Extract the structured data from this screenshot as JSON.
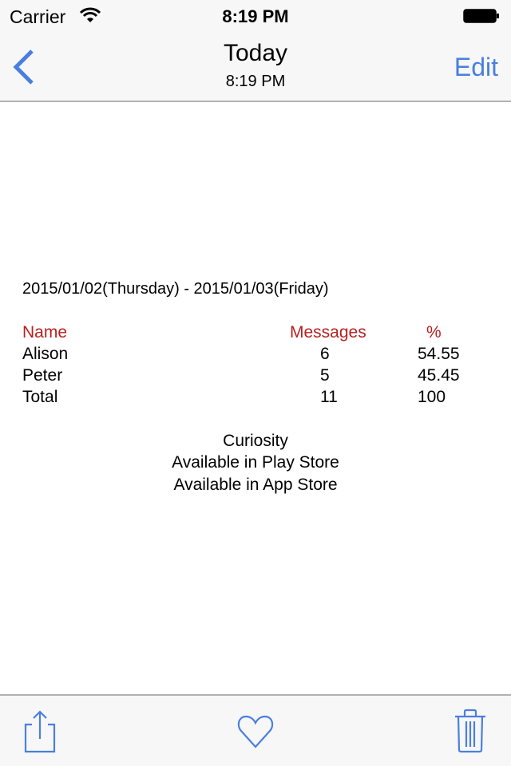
{
  "status_bar": {
    "carrier": "Carrier",
    "time": "8:19 PM",
    "wifi_icon": "wifi-icon",
    "battery_icon": "battery-full-icon"
  },
  "nav": {
    "back_icon": "chevron-left-icon",
    "title": "Today",
    "subtitle": "8:19 PM",
    "edit_label": "Edit",
    "accent_color": "#4a7fe0"
  },
  "report": {
    "date_range": "2015/01/02(Thursday) - 2015/01/03(Friday)",
    "header_color": "#b81f1f",
    "columns": [
      "Name",
      "Messages",
      "%"
    ],
    "rows": [
      {
        "name": "Alison",
        "messages": "6",
        "percent": "54.55"
      },
      {
        "name": "Peter",
        "messages": "5",
        "percent": "45.45"
      },
      {
        "name": "Total",
        "messages": "11",
        "percent": "100"
      }
    ],
    "footer_lines": [
      "Curiosity",
      "Available in Play Store",
      "Available in App Store"
    ]
  },
  "toolbar": {
    "share_icon": "share-icon",
    "favorite_icon": "heart-icon",
    "delete_icon": "trash-icon"
  }
}
